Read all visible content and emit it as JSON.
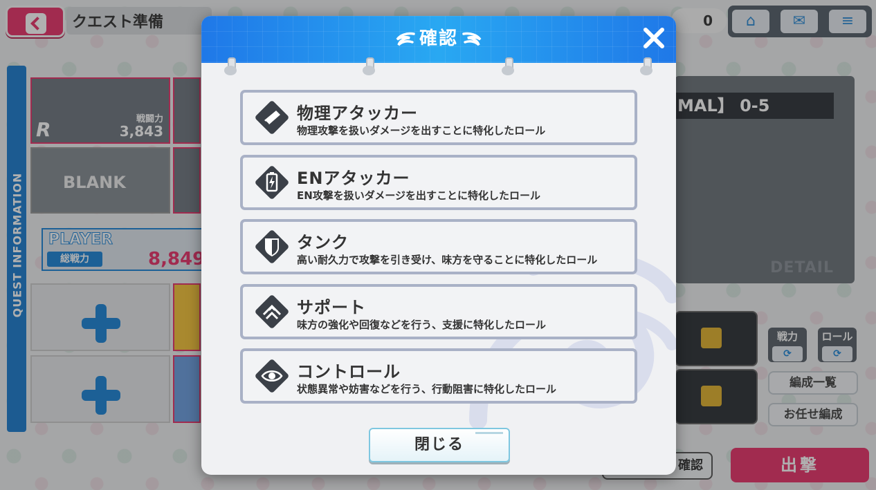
{
  "background": {
    "screen_title": "クエスト準備",
    "currency_value": "0",
    "top_icons": [
      "home-icon",
      "mail-icon",
      "menu-icon"
    ],
    "side_label": "QUEST INFORMATION",
    "card_power_label": "戦闘力",
    "card_power_value": "3,843",
    "blank_label": "BLANK",
    "player_label": "PLAYER",
    "total_power_label": "総戦力",
    "total_power_value": "8,849",
    "stage_label": "MAL】 0-5",
    "detail_label": "DETAIL",
    "sort_power_label": "戦力",
    "sort_role_label": "ロール",
    "formation_list_label": "編成一覧",
    "auto_formation_label": "お任せ編成",
    "confirm_label": "確認",
    "sortie_label": "出撃"
  },
  "modal": {
    "title": "確認",
    "close_button_label": "閉じる",
    "roles": [
      {
        "name": "物理アタッカー",
        "description": "物理攻撃を扱いダメージを出すことに特化したロール",
        "icon": "physical-attacker-icon"
      },
      {
        "name": "ENアタッカー",
        "description": "EN攻撃を扱いダメージを出すことに特化したロール",
        "icon": "en-attacker-icon"
      },
      {
        "name": "タンク",
        "description": "高い耐久力で攻撃を引き受け、味方を守ることに特化したロール",
        "icon": "tank-icon"
      },
      {
        "name": "サポート",
        "description": "味方の強化や回復などを行う、支援に特化したロール",
        "icon": "support-icon"
      },
      {
        "name": "コントロール",
        "description": "状態異常や妨害などを行う、行動阻害に特化したロール",
        "icon": "control-icon"
      }
    ]
  },
  "colors": {
    "header_blue": "#1f78e8",
    "accent_pink": "#e8336a",
    "role_border": "#a9b1c6",
    "icon_dark": "#3b4048"
  }
}
